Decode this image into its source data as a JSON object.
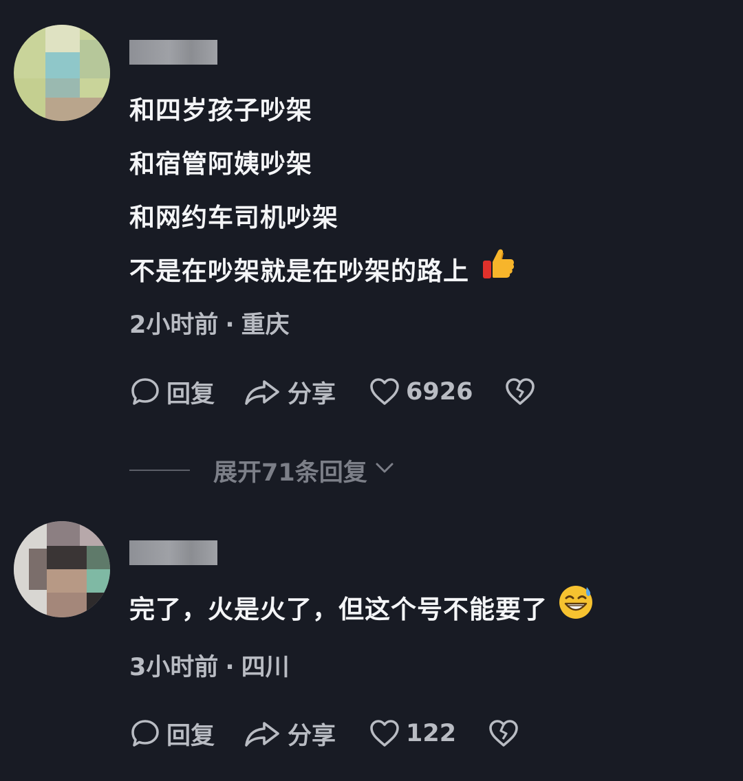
{
  "comments": [
    {
      "lines": [
        "和四岁孩子吵架",
        "和宿管阿姨吵架",
        "和网约车司机吵架",
        "不是在吵架就是在吵架的路上"
      ],
      "emoji": "thumbs-up-emoji",
      "time": "2小时前",
      "separator": "·",
      "location": "重庆",
      "actions": {
        "reply": "回复",
        "share": "分享",
        "likes": "6926"
      },
      "expand_replies": "展开71条回复"
    },
    {
      "lines": [
        "完了，火是火了，但这个号不能要了"
      ],
      "emoji": "grinning-sweat-emoji",
      "time": "3小时前",
      "separator": "·",
      "location": "四川",
      "actions": {
        "reply": "回复",
        "share": "分享",
        "likes": "122"
      }
    }
  ],
  "icons": {
    "reply": "speech-bubble-icon",
    "share": "share-arrow-icon",
    "like": "heart-icon",
    "dislike": "broken-heart-icon",
    "expand": "chevron-down-icon"
  },
  "colors": {
    "background": "#181b24",
    "text_primary": "#f4f5f7",
    "text_secondary": "#b9bcc3",
    "text_muted": "#7c7f88"
  }
}
